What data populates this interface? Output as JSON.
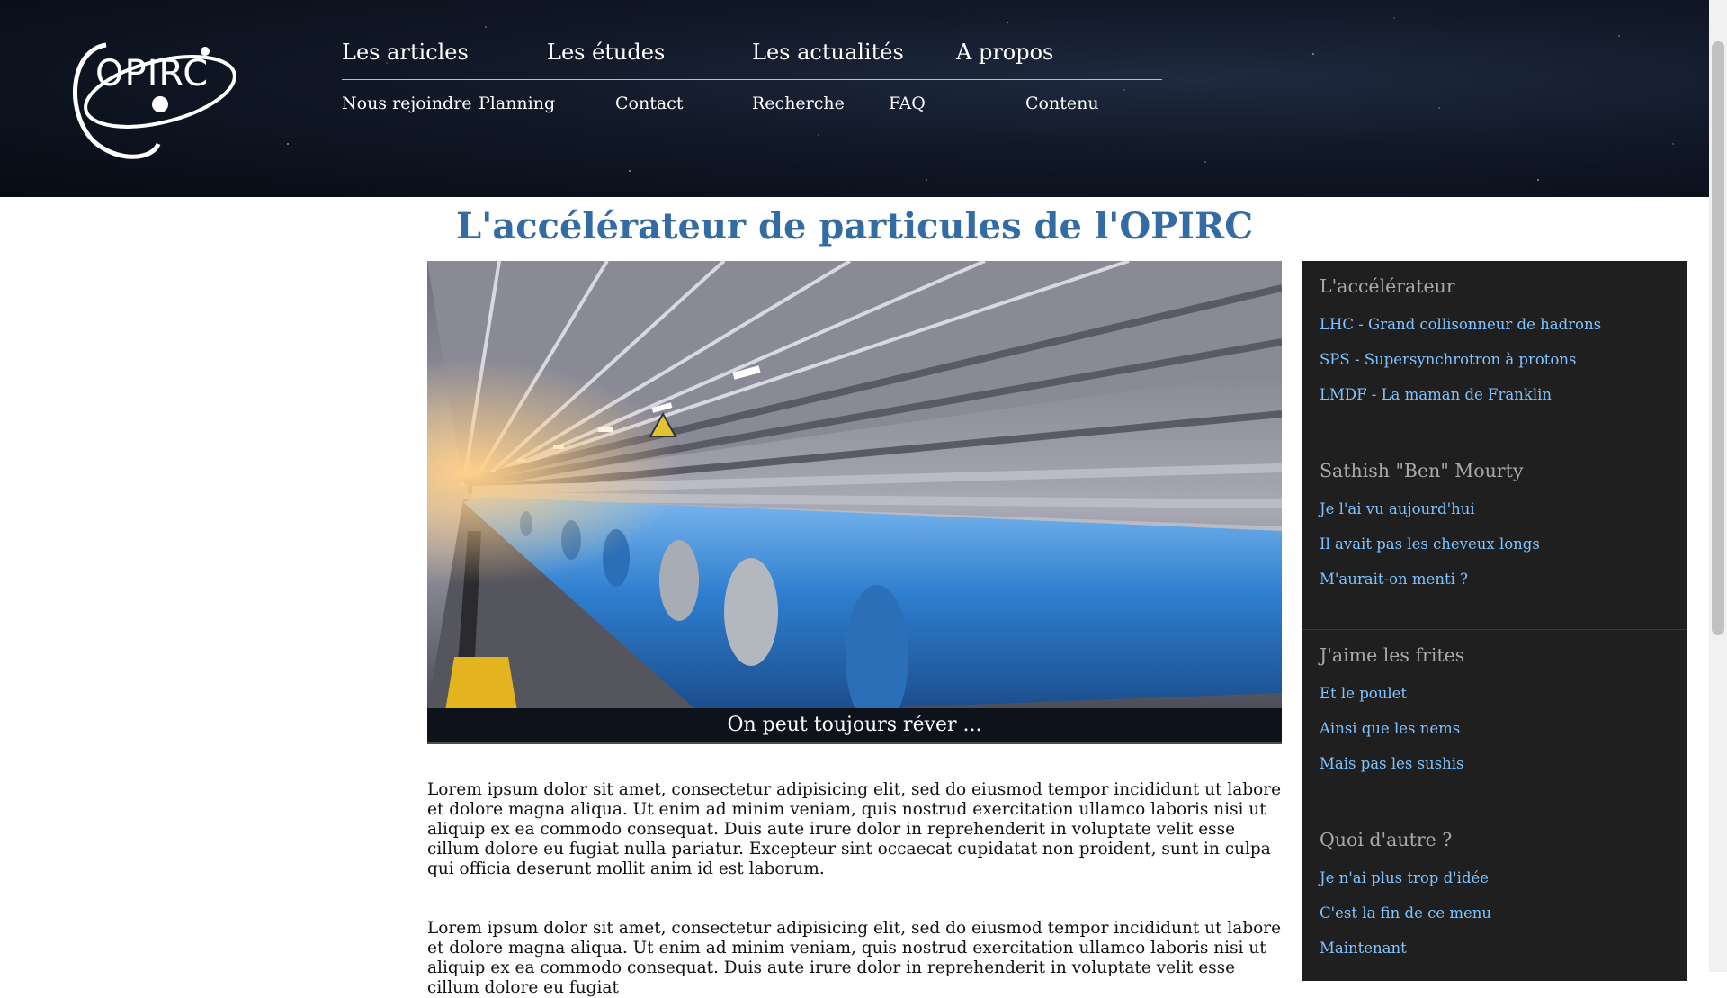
{
  "header": {
    "logo_text": "OPIRC",
    "nav_primary": [
      "Les articles",
      "Les études",
      "Les actualités",
      "A propos"
    ],
    "nav_secondary": [
      "Nous rejoindre",
      "Planning",
      "Contact",
      "Recherche",
      "FAQ",
      "Contenu"
    ]
  },
  "main": {
    "title": "L'accélérateur de particules de l'OPIRC",
    "figure_caption": "On peut toujours réver ...",
    "paragraphs": [
      "Lorem ipsum dolor sit amet, consectetur adipisicing elit, sed do eiusmod tempor incididunt ut labore et dolore magna aliqua. Ut enim ad minim veniam, quis nostrud exercitation ullamco laboris nisi ut aliquip ex ea commodo consequat. Duis aute irure dolor in reprehenderit in voluptate velit esse cillum dolore eu fugiat nulla pariatur. Excepteur sint occaecat cupidatat non proident, sunt in culpa qui officia deserunt mollit anim id est laborum.",
      "Lorem ipsum dolor sit amet, consectetur adipisicing elit, sed do eiusmod tempor incididunt ut labore et dolore magna aliqua. Ut enim ad minim veniam, quis nostrud exercitation ullamco laboris nisi ut aliquip ex ea commodo consequat. Duis aute irure dolor in reprehenderit in voluptate velit esse cillum dolore eu fugiat"
    ]
  },
  "sidebar": {
    "sections": [
      {
        "heading": "L'accélérateur",
        "links": [
          "LHC - Grand collisonneur de hadrons",
          "SPS - Supersynchrotron à protons",
          "LMDF - La maman de Franklin"
        ]
      },
      {
        "heading": "Sathish \"Ben\" Mourty",
        "links": [
          "Je l'ai vu aujourd'hui",
          "Il avait pas les cheveux longs",
          "M'aurait-on menti ?"
        ]
      },
      {
        "heading": "J'aime les frites",
        "links": [
          "Et le poulet",
          "Ainsi que les nems",
          "Mais pas les sushis"
        ]
      },
      {
        "heading": "Quoi d'autre ?",
        "links": [
          "Je n'ai plus trop d'idée",
          "C'est la fin de ce menu",
          "Maintenant"
        ]
      }
    ]
  },
  "colors": {
    "title": "#336ba4",
    "sidebar_bg": "#1f1f1f",
    "sidebar_heading": "#a9a9a9",
    "sidebar_link": "#7ec3ff",
    "header_bg": "#0b101a"
  }
}
